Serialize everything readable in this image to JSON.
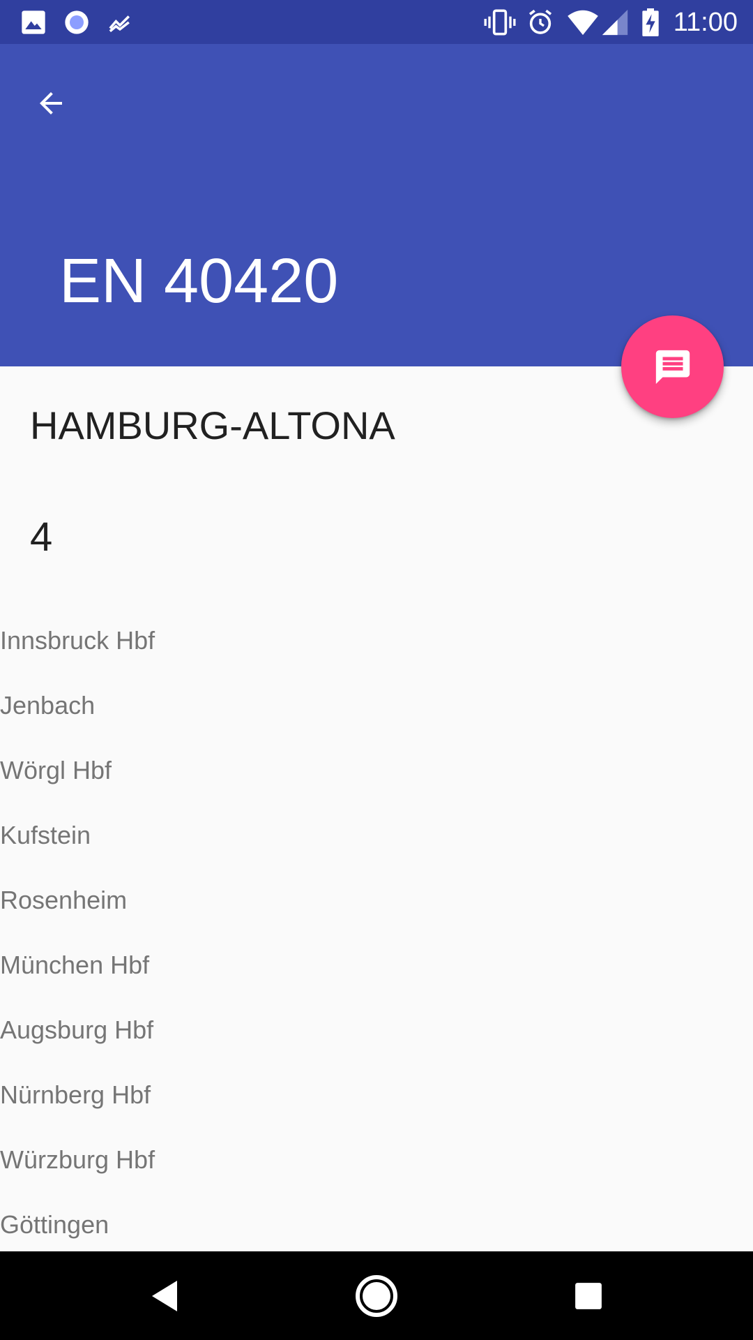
{
  "status_bar": {
    "time": "11:00",
    "icons": [
      "image-notification-icon",
      "circle-notification-icon",
      "chart-notification-icon",
      "vibrate-icon",
      "alarm-icon",
      "wifi-icon",
      "signal-icon",
      "battery-charging-icon"
    ]
  },
  "app_bar": {
    "back_icon": "arrow-back-icon",
    "title": "EN 40420",
    "color": "#3f51b5",
    "status_color": "#303f9f"
  },
  "fab": {
    "icon": "message-icon",
    "color": "#ff4081"
  },
  "details": {
    "destination": "HAMBURG-ALTONA",
    "platform": "4"
  },
  "stops": [
    "Innsbruck Hbf",
    "Jenbach",
    "Wörgl Hbf",
    "Kufstein",
    "Rosenheim",
    "München Hbf",
    "Augsburg Hbf",
    "Nürnberg Hbf",
    "Würzburg Hbf",
    "Göttingen"
  ],
  "nav_bar": {
    "back": "nav-back-icon",
    "home": "nav-home-icon",
    "recents": "nav-recents-icon"
  }
}
